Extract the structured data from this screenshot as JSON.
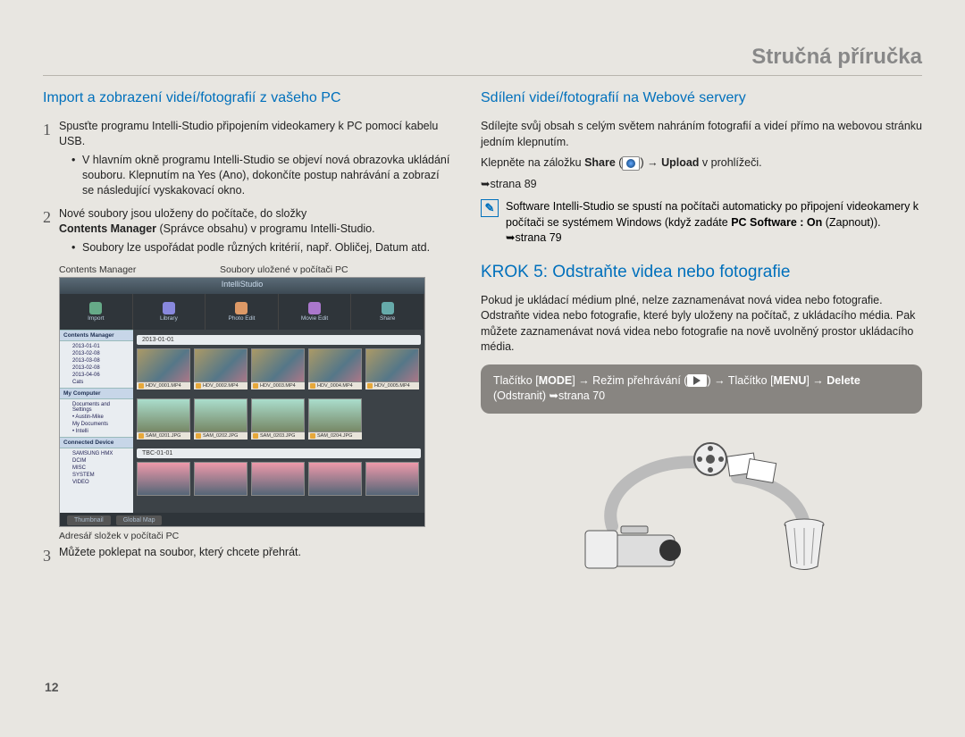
{
  "page": {
    "title": "Stručná příručka",
    "number": "12"
  },
  "left": {
    "heading": "Import a zobrazení videí/fotografií z vašeho PC",
    "step1": "Spusťte programu Intelli-Studio připojením videokamery k PC pomocí kabelu USB.",
    "step1_sub": "V hlavním okně programu Intelli-Studio se objeví nová obrazovka ukládání souboru. Klepnutím na Yes (Ano), dokončíte postup nahrávání a zobrazí se následující vyskakovací okno.",
    "step2": "Nové soubory jsou uloženy do počítače, do složky",
    "step2_bold1": "Contents Manager",
    "step2_rest": " (Správce obsahu) v programu Intelli-Studio.",
    "step2_sub": "Soubory lze uspořádat podle různých kritérií, např. Obličej, Datum atd.",
    "caption_cm": "Contents Manager",
    "caption_saved": "Soubory uložené v počítači PC",
    "caption_folder": "Adresář složek v počítači PC",
    "step3": "Můžete poklepat na soubor, který chcete přehrát."
  },
  "screenshot": {
    "app_title": "IntelliStudio",
    "toolbar": [
      "Import",
      "Library",
      "Photo Edit",
      "Movie Edit",
      "Share"
    ],
    "side_grp1_hdr": "Contents Manager",
    "side_grp1_items": [
      "2013-01-01",
      "2013-02-08",
      "2013-03-08",
      "2013-02-08",
      "2013-04-06",
      "Cats"
    ],
    "side_grp2_hdr": "My Computer",
    "side_grp2_items": [
      "Documents and Settings",
      "• Austin-Mike",
      "My Documents",
      "• Intelli"
    ],
    "side_grp3_hdr": "Connected Device",
    "side_grp3_items": [
      "SAMSUNG HMX",
      "DCIM",
      "MISC",
      "SYSTEM",
      "VIDEO"
    ],
    "date1": "2013-01-01",
    "date2": "TBC-01-01",
    "row1_labels": [
      "HDV_0001.MP4",
      "HDV_0002.MP4",
      "HDV_0003.MP4",
      "HDV_0004.MP4",
      "HDV_0005.MP4"
    ],
    "row2_labels": [
      "SAM_0201.JPG",
      "SAM_0202.JPG",
      "SAM_0203.JPG",
      "SAM_0204.JPG"
    ],
    "row3_labels": [
      "",
      "",
      "",
      "",
      ""
    ],
    "status": [
      "Thumbnail",
      "Global Map"
    ]
  },
  "right": {
    "heading1": "Sdílení videí/fotografií na Webové servery",
    "p1": "Sdílejte svůj obsah s celým světem nahráním fotografií a videí přímo na webovou stránku jedním klepnutím.",
    "p2a": "Klepněte na záložku ",
    "p2_bold1": "Share",
    "p2b": " (",
    "p2c": ") ",
    "p2_arrow": "→",
    "p2_bold2": "Upload",
    "p2d": " v prohlížeči.",
    "p2_ref": "➥strana 89",
    "note_a": "Software Intelli-Studio se spustí na počítači automaticky po připojení videokamery k počítači se systémem Windows (když zadáte ",
    "note_bold": "PC Software : On",
    "note_b": " (Zapnout)). ➥strana 79",
    "heading2": "KROK 5: Odstraňte videa nebo fotografie",
    "p3": "Pokud je ukládací médium plné, nelze zaznamenávat nová videa nebo fotografie. Odstraňte videa nebo fotografie, které byly uloženy na počítač, z ukládacího média. Pak můžete zaznamenávat nová videa nebo fotografie na nově uvolněný prostor ukládacího média.",
    "grey_a": "Tlačítko ",
    "grey_b1": "MODE",
    "grey_b": " → Režim přehrávání (",
    "grey_c": ") → Tlačítko [",
    "grey_b2": "MENU",
    "grey_d": "] → ",
    "grey_b3": "Delete",
    "grey_e": " (Odstranit) ➥strana 70"
  }
}
